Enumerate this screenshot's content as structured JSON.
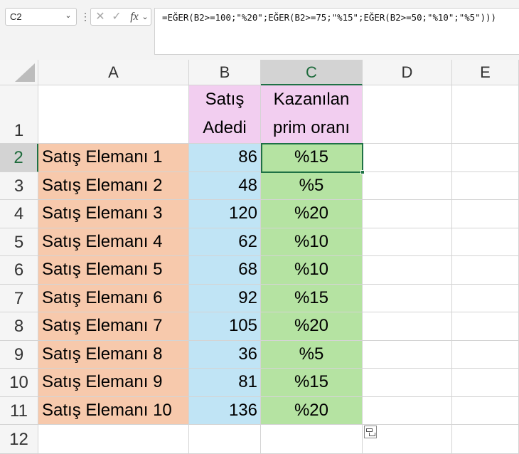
{
  "name_box": {
    "value": "C2"
  },
  "formula_bar": {
    "formula": "=EĞER(B2>=100;\"%20\";EĞER(B2>=75;\"%15\";EĞER(B2>=50;\"%10\";\"%5\")))"
  },
  "icons": {
    "more": "⋮",
    "cancel": "✕",
    "enter": "✓",
    "function": "fx",
    "dropdown": "⌄"
  },
  "columns": [
    "A",
    "B",
    "C",
    "D",
    "E"
  ],
  "active_column": "C",
  "active_row": "2",
  "rows": [
    "1",
    "2",
    "3",
    "4",
    "5",
    "6",
    "7",
    "8",
    "9",
    "10",
    "11",
    "12"
  ],
  "header": {
    "b_line1": "Satış",
    "b_line2": "Adedi",
    "c_line1": "Kazanılan",
    "c_line2": "prim oranı"
  },
  "data_rows": [
    {
      "name": "Satış Elemanı 1",
      "sales": "86",
      "rate": "%15"
    },
    {
      "name": "Satış Elemanı 2",
      "sales": "48",
      "rate": "%5"
    },
    {
      "name": "Satış Elemanı 3",
      "sales": "120",
      "rate": "%20"
    },
    {
      "name": "Satış Elemanı 4",
      "sales": "62",
      "rate": "%10"
    },
    {
      "name": "Satış Elemanı 5",
      "sales": "68",
      "rate": "%10"
    },
    {
      "name": "Satış Elemanı 6",
      "sales": "92",
      "rate": "%15"
    },
    {
      "name": "Satış Elemanı 7",
      "sales": "105",
      "rate": "%20"
    },
    {
      "name": "Satış Elemanı 8",
      "sales": "36",
      "rate": "%5"
    },
    {
      "name": "Satış Elemanı 9",
      "sales": "81",
      "rate": "%15"
    },
    {
      "name": "Satış Elemanı 10",
      "sales": "136",
      "rate": "%20"
    }
  ],
  "colors": {
    "name_fill": "#f7c9ac",
    "sales_fill": "#c0e4f5",
    "rate_fill": "#b5e3a2",
    "header_fill": "#f2cef0",
    "selection": "#1e7145"
  }
}
